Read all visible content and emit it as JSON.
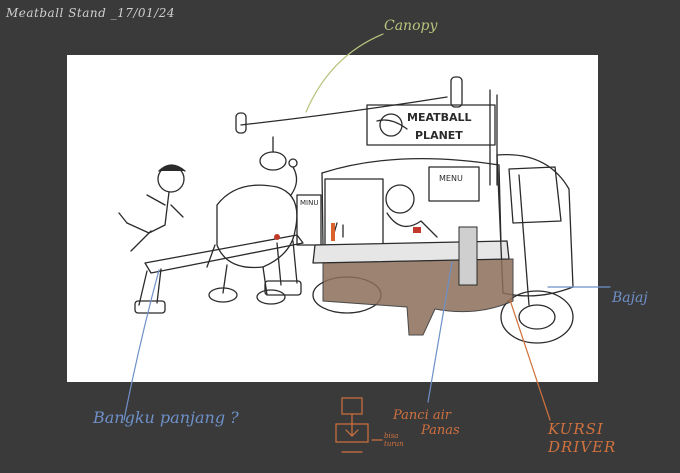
{
  "title": "Meatball Stand _17/01/24",
  "sign": {
    "line1": "MEATBALL",
    "line2": "PLANET"
  },
  "menu_board": "MENU",
  "side_board": "MINU",
  "annotations": {
    "canopy": "Canopy",
    "bajaj": "Bajaj",
    "bangku": "Bangku panjang ?",
    "panci_line1": "Panci air",
    "panci_line2": "Panas",
    "kursi_line1": "KURSI",
    "kursi_line2": "DRIVER",
    "bisa_line1": "bisa",
    "bisa_line2": "turun"
  },
  "colors": {
    "background": "#3a3a3b",
    "canvas": "#ffffff",
    "sketch": "#2b2b2b",
    "cart_brown": "#8b6e5a",
    "note_green": "#b9c27c",
    "note_blue": "#6e90c8",
    "note_orange": "#d0713e"
  }
}
